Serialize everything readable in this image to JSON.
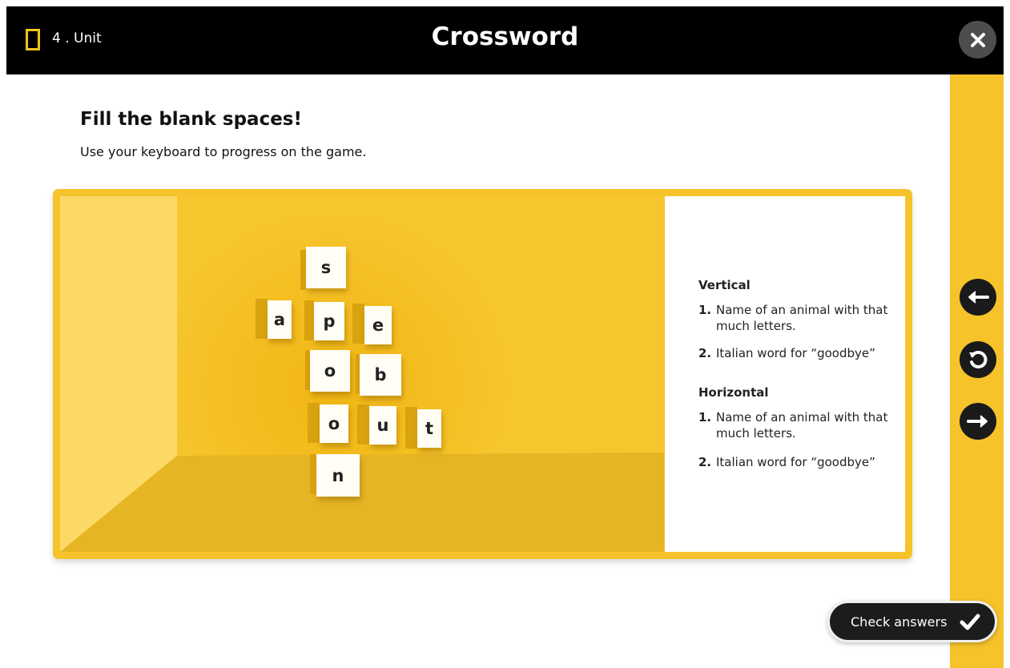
{
  "header": {
    "unit_label": "4 . Unit",
    "title": "Crossword"
  },
  "instructions": {
    "heading": "Fill the blank spaces!",
    "subheading": "Use your keyboard to progress on the game."
  },
  "puzzle": {
    "tiles": [
      "s",
      "a",
      "p",
      "e",
      "o",
      "b",
      "o",
      "u",
      "t",
      "n"
    ]
  },
  "clues": {
    "vertical_heading": "Vertical",
    "vertical": [
      {
        "num": "1.",
        "text": "Name of an animal with that much letters."
      },
      {
        "num": "2.",
        "text": "Italian word for “goodbye”"
      }
    ],
    "horizontal_heading": "Horizontal",
    "horizontal": [
      {
        "num": "1.",
        "text": "Name of an animal with that much letters."
      },
      {
        "num": "2.",
        "text": "Italian word for “goodbye”"
      }
    ]
  },
  "actions": {
    "check_answers": "Check answers"
  },
  "icons": {
    "close": "close-icon",
    "prev": "arrow-left-icon",
    "reset": "reset-icon",
    "next": "arrow-right-icon",
    "check": "checkmark-icon"
  },
  "colors": {
    "accent_yellow": "#f6c32b",
    "dark": "#000000"
  }
}
